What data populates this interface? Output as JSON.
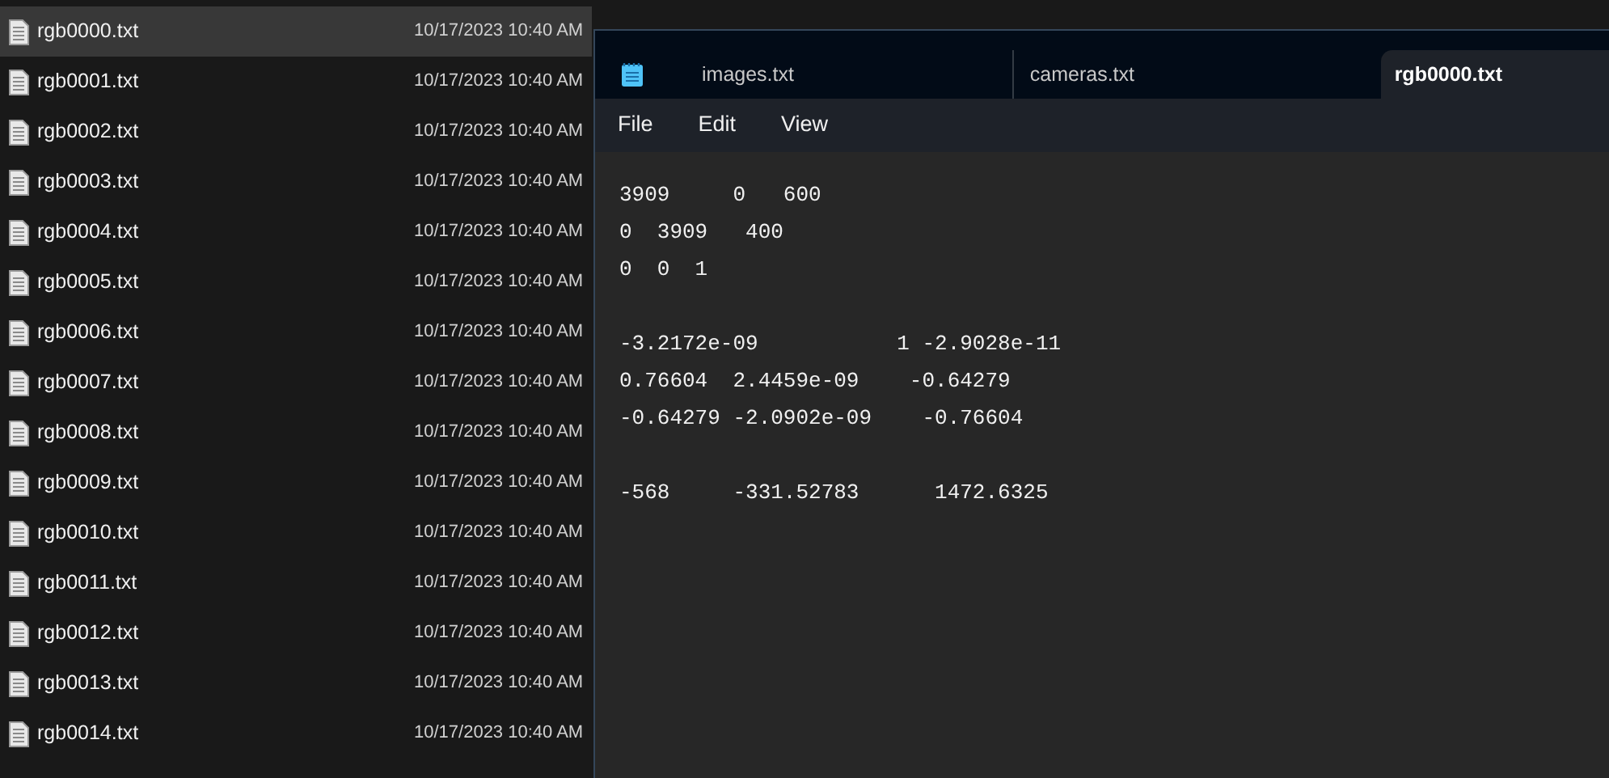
{
  "explorer": {
    "files": [
      {
        "name": "rgb0000.txt",
        "modified": "10/17/2023 10:40 AM",
        "selected": true
      },
      {
        "name": "rgb0001.txt",
        "modified": "10/17/2023 10:40 AM",
        "selected": false
      },
      {
        "name": "rgb0002.txt",
        "modified": "10/17/2023 10:40 AM",
        "selected": false
      },
      {
        "name": "rgb0003.txt",
        "modified": "10/17/2023 10:40 AM",
        "selected": false
      },
      {
        "name": "rgb0004.txt",
        "modified": "10/17/2023 10:40 AM",
        "selected": false
      },
      {
        "name": "rgb0005.txt",
        "modified": "10/17/2023 10:40 AM",
        "selected": false
      },
      {
        "name": "rgb0006.txt",
        "modified": "10/17/2023 10:40 AM",
        "selected": false
      },
      {
        "name": "rgb0007.txt",
        "modified": "10/17/2023 10:40 AM",
        "selected": false
      },
      {
        "name": "rgb0008.txt",
        "modified": "10/17/2023 10:40 AM",
        "selected": false
      },
      {
        "name": "rgb0009.txt",
        "modified": "10/17/2023 10:40 AM",
        "selected": false
      },
      {
        "name": "rgb0010.txt",
        "modified": "10/17/2023 10:40 AM",
        "selected": false
      },
      {
        "name": "rgb0011.txt",
        "modified": "10/17/2023 10:40 AM",
        "selected": false
      },
      {
        "name": "rgb0012.txt",
        "modified": "10/17/2023 10:40 AM",
        "selected": false
      },
      {
        "name": "rgb0013.txt",
        "modified": "10/17/2023 10:40 AM",
        "selected": false
      },
      {
        "name": "rgb0014.txt",
        "modified": "10/17/2023 10:40 AM",
        "selected": false
      }
    ]
  },
  "notepad": {
    "tabs": [
      {
        "label": "images.txt",
        "selected": false
      },
      {
        "label": "cameras.txt",
        "selected": false
      },
      {
        "label": "rgb0000.txt",
        "selected": true
      }
    ],
    "menu": [
      "File",
      "Edit",
      "View"
    ],
    "blocks": [
      [
        "3909     0   600",
        "0  3909   400",
        "0  0  1"
      ],
      [
        "-3.2172e-09           1 -2.9028e-11",
        "0.76604  2.4459e-09    -0.64279",
        "-0.64279 -2.0902e-09    -0.76604"
      ],
      [
        "-568     -331.52783      1472.6325"
      ]
    ]
  }
}
